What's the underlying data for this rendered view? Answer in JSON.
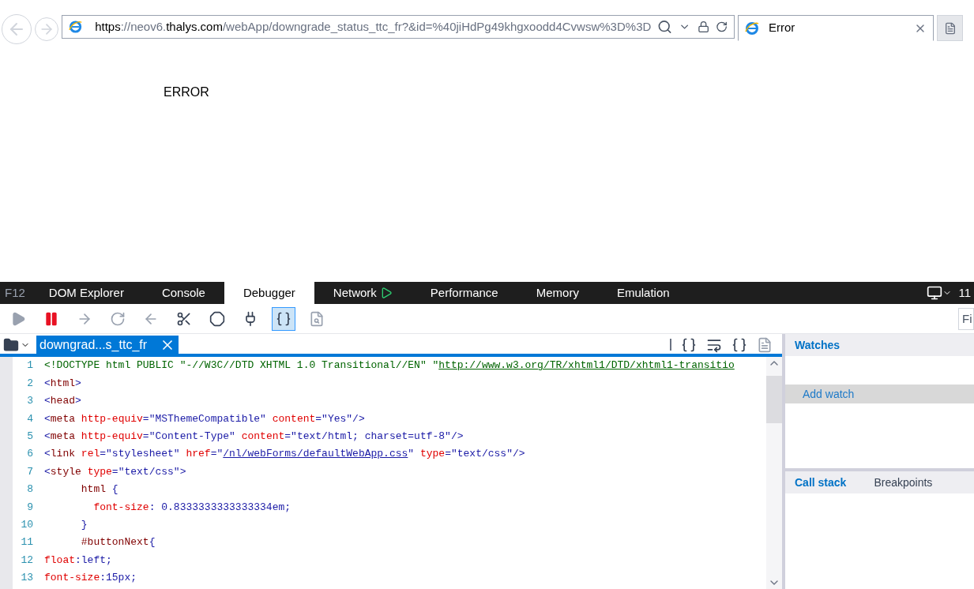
{
  "browser": {
    "address": "**https**://neov6.**thalys.com**/webApp/downgrade_status_ttc_fr?&id=%40jiHdPg49khgxoodd4Cvwsw%3D%3D",
    "tabs": [
      {
        "title": "Error",
        "selected": true
      }
    ]
  },
  "page": {
    "text": "ERROR"
  },
  "devtools": {
    "label": "F12",
    "tabs": [
      {
        "label": "DOM Explorer",
        "selected": false,
        "recording": false
      },
      {
        "label": "Console",
        "selected": false,
        "recording": false
      },
      {
        "label": "Debugger",
        "selected": true,
        "recording": false
      },
      {
        "label": "Network",
        "selected": false,
        "recording": true
      },
      {
        "label": "Performance",
        "selected": false,
        "recording": false
      },
      {
        "label": "Memory",
        "selected": false,
        "recording": false
      },
      {
        "label": "Emulation",
        "selected": false,
        "recording": false
      }
    ],
    "version": "11",
    "toolbar": [
      {
        "kind": "continue",
        "disabled": true,
        "selected": false
      },
      {
        "kind": "break",
        "disabled": false,
        "selected": false
      },
      {
        "kind": "step_into",
        "disabled": true,
        "selected": false
      },
      {
        "kind": "step_over",
        "disabled": true,
        "selected": false
      },
      {
        "kind": "step_out",
        "disabled": true,
        "selected": false
      },
      {
        "kind": "break_new_worker",
        "disabled": false,
        "selected": false
      },
      {
        "kind": "exceptions",
        "disabled": false,
        "selected": false
      },
      {
        "kind": "disconnect",
        "disabled": false,
        "selected": false
      },
      {
        "kind": "just_my_code",
        "disabled": false,
        "selected": true
      },
      {
        "kind": "find_references",
        "disabled": true,
        "selected": false
      }
    ],
    "find": {
      "placeholder": "Fi"
    },
    "file_tabs": [
      {
        "label": "downgrad...s_ttc_fr",
        "selected": true
      }
    ],
    "code": [
      {
        "number": "1",
        "tokens": [
          {
            "kind": "doctype",
            "text": "<!DOCTYPE html PUBLIC \"-//W3C//DTD XHTML 1.0 Transitional//EN\" \""
          },
          {
            "kind": "doctype_link",
            "text": "http://www.w3.org/TR/xhtml1/DTD/xhtml1-transitio"
          }
        ]
      },
      {
        "number": "2",
        "tokens": [
          {
            "kind": "punct",
            "text": "<"
          },
          {
            "kind": "tag",
            "text": "html"
          },
          {
            "kind": "punct",
            "text": ">"
          }
        ]
      },
      {
        "number": "3",
        "tokens": [
          {
            "kind": "punct",
            "text": "<"
          },
          {
            "kind": "tag",
            "text": "head"
          },
          {
            "kind": "punct",
            "text": ">"
          }
        ]
      },
      {
        "number": "4",
        "tokens": [
          {
            "kind": "punct",
            "text": "<"
          },
          {
            "kind": "tag",
            "text": "meta "
          },
          {
            "kind": "attr",
            "text": "http-equiv"
          },
          {
            "kind": "punct",
            "text": "=\"MSThemeCompatible\" "
          },
          {
            "kind": "attr",
            "text": "content"
          },
          {
            "kind": "punct",
            "text": "=\"Yes\"/>"
          }
        ]
      },
      {
        "number": "5",
        "tokens": [
          {
            "kind": "punct",
            "text": "<"
          },
          {
            "kind": "tag",
            "text": "meta "
          },
          {
            "kind": "attr",
            "text": "http-equiv"
          },
          {
            "kind": "punct",
            "text": "=\"Content-Type\" "
          },
          {
            "kind": "attr",
            "text": "content"
          },
          {
            "kind": "punct",
            "text": "=\"text/html; charset=utf-8\"/>"
          }
        ]
      },
      {
        "number": "6",
        "tokens": [
          {
            "kind": "punct",
            "text": "<"
          },
          {
            "kind": "tag",
            "text": "link "
          },
          {
            "kind": "attr",
            "text": "rel"
          },
          {
            "kind": "punct",
            "text": "=\"stylesheet\" "
          },
          {
            "kind": "attr",
            "text": "href"
          },
          {
            "kind": "punct",
            "text": "=\""
          },
          {
            "kind": "link",
            "text": "/nl/webForms/defaultWebApp.css"
          },
          {
            "kind": "punct",
            "text": "\" "
          },
          {
            "kind": "attr",
            "text": "type"
          },
          {
            "kind": "punct",
            "text": "=\"text/css\"/>"
          }
        ]
      },
      {
        "number": "7",
        "tokens": [
          {
            "kind": "punct",
            "text": "<"
          },
          {
            "kind": "tag",
            "text": "style "
          },
          {
            "kind": "attr",
            "text": "type"
          },
          {
            "kind": "punct",
            "text": "=\"text/css\">"
          }
        ]
      },
      {
        "number": "8",
        "tokens": [
          {
            "kind": "tag",
            "text": "      html "
          },
          {
            "kind": "punct",
            "text": "{"
          }
        ]
      },
      {
        "number": "9",
        "tokens": [
          {
            "kind": "attr",
            "text": "        font-size"
          },
          {
            "kind": "punct",
            "text": ": 0.8333333333333334em;"
          }
        ]
      },
      {
        "number": "10",
        "tokens": [
          {
            "kind": "punct",
            "text": "      }"
          }
        ]
      },
      {
        "number": "11",
        "tokens": [
          {
            "kind": "tag",
            "text": "      #buttonNext"
          },
          {
            "kind": "punct",
            "text": "{"
          }
        ]
      },
      {
        "number": "12",
        "tokens": [
          {
            "kind": "attr",
            "text": "float"
          },
          {
            "kind": "punct",
            "text": ":left;"
          }
        ]
      },
      {
        "number": "13",
        "tokens": [
          {
            "kind": "attr",
            "text": "font-size"
          },
          {
            "kind": "punct",
            "text": ":15px;"
          }
        ]
      }
    ],
    "watches": {
      "title": "Watches",
      "add": "Add watch"
    },
    "bottom_tabs": [
      {
        "label": "Call stack",
        "selected": true
      },
      {
        "label": "Breakpoints",
        "selected": false
      }
    ]
  }
}
